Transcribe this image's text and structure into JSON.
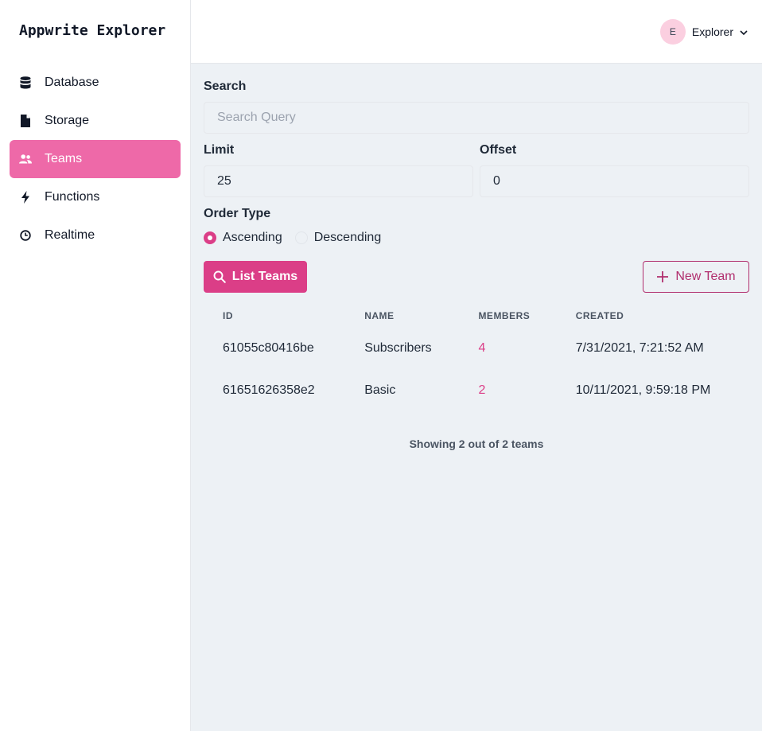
{
  "app": {
    "title": "Appwrite Explorer"
  },
  "sidebar": {
    "items": [
      {
        "label": "Database",
        "icon": "database-icon",
        "active": false
      },
      {
        "label": "Storage",
        "icon": "file-icon",
        "active": false
      },
      {
        "label": "Teams",
        "icon": "users-icon",
        "active": true
      },
      {
        "label": "Functions",
        "icon": "lightning-icon",
        "active": false
      },
      {
        "label": "Realtime",
        "icon": "clock-icon",
        "active": false
      }
    ]
  },
  "user": {
    "initial": "E",
    "name": "Explorer"
  },
  "form": {
    "search": {
      "label": "Search",
      "placeholder": "Search Query",
      "value": ""
    },
    "limit": {
      "label": "Limit",
      "value": "25"
    },
    "offset": {
      "label": "Offset",
      "value": "0"
    },
    "order_type": {
      "label": "Order Type",
      "options": [
        "Ascending",
        "Descending"
      ],
      "selected": "Ascending"
    },
    "list_button": "List Teams",
    "new_button": "New Team"
  },
  "table": {
    "columns": [
      "ID",
      "NAME",
      "MEMBERS",
      "CREATED"
    ],
    "rows": [
      {
        "id": "61055c80416be",
        "name": "Subscribers",
        "members": "4",
        "created": "7/31/2021, 7:21:52 AM"
      },
      {
        "id": "61651626358e2",
        "name": "Basic",
        "members": "2",
        "created": "10/11/2021, 9:59:18 PM"
      }
    ]
  },
  "footer": "Showing 2 out of 2 teams",
  "colors": {
    "accent": "#db3e87",
    "active_nav": "#ee69a8",
    "background": "#edf1f5"
  }
}
